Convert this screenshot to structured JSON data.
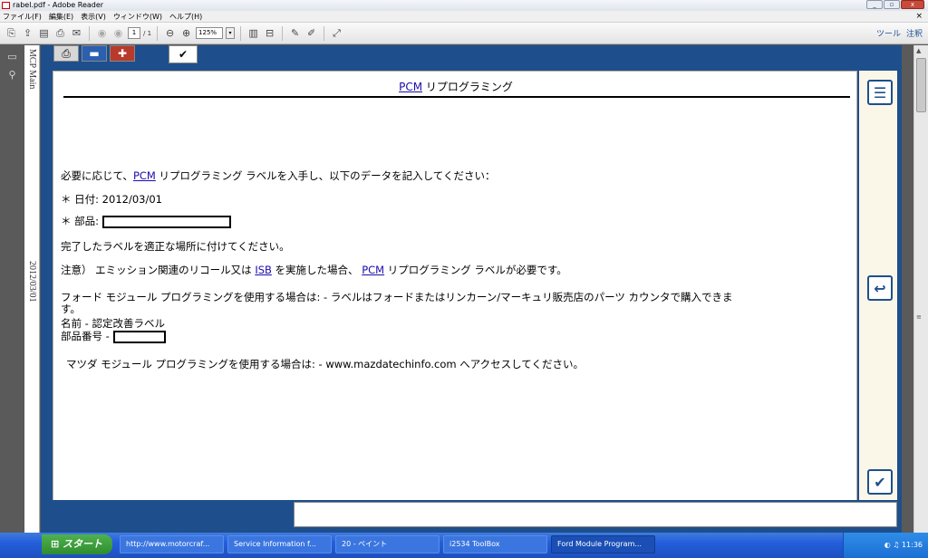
{
  "window": {
    "title": "rabel.pdf - Adobe Reader",
    "close_glyph": "×"
  },
  "menu": [
    "ファイル(F)",
    "編集(E)",
    "表示(V)",
    "ウィンドウ(W)",
    "ヘルプ(H)"
  ],
  "toolbar": {
    "page": "1",
    "total": "/ 1",
    "zoom": "125%",
    "tools": "ツール",
    "comment": "注釈"
  },
  "sidebar_text": {
    "top": "MCP Main",
    "date": "2012/03/01"
  },
  "doc": {
    "title_link": "PCM",
    "title_rest": " リプログラミング",
    "line1_pre": "必要に応じて、",
    "line1_link": "PCM",
    "line1_post": " リプログラミング ラベルを入手し、以下のデータを記入してください：",
    "date_line": "＊ 日付: 2012/03/01",
    "part_label": "＊ 部品:",
    "line4": "完了したラベルを適正な場所に付けてください。",
    "line5_pre": "注意） エミッション関連のリコール又は ",
    "line5_link1": "ISB",
    "line5_mid": " を実施した場合、 ",
    "line5_link2": "PCM",
    "line5_post": " リプログラミング ラベルが必要です。",
    "line6": "フォード モジュール プログラミングを使用する場合は: - ラベルはフォードまたはリンカーン/マーキュリ販売店のパーツ カウンタで購入できま",
    "line6b": "す。",
    "line7": "名前 - 認定改善ラベル",
    "line8_label": "部品番号 -",
    "line9": "マツダ モジュール プログラミングを使用する場合は: - www.mazdatechinfo.com へアクセスしてください。"
  },
  "taskbar": {
    "start": "スタート",
    "tasks": [
      "http://www.motorcraf...",
      "Service Information f...",
      "20 - ペイント",
      "i2534 ToolBox",
      "Ford Module Program..."
    ],
    "clock": "11:36"
  }
}
